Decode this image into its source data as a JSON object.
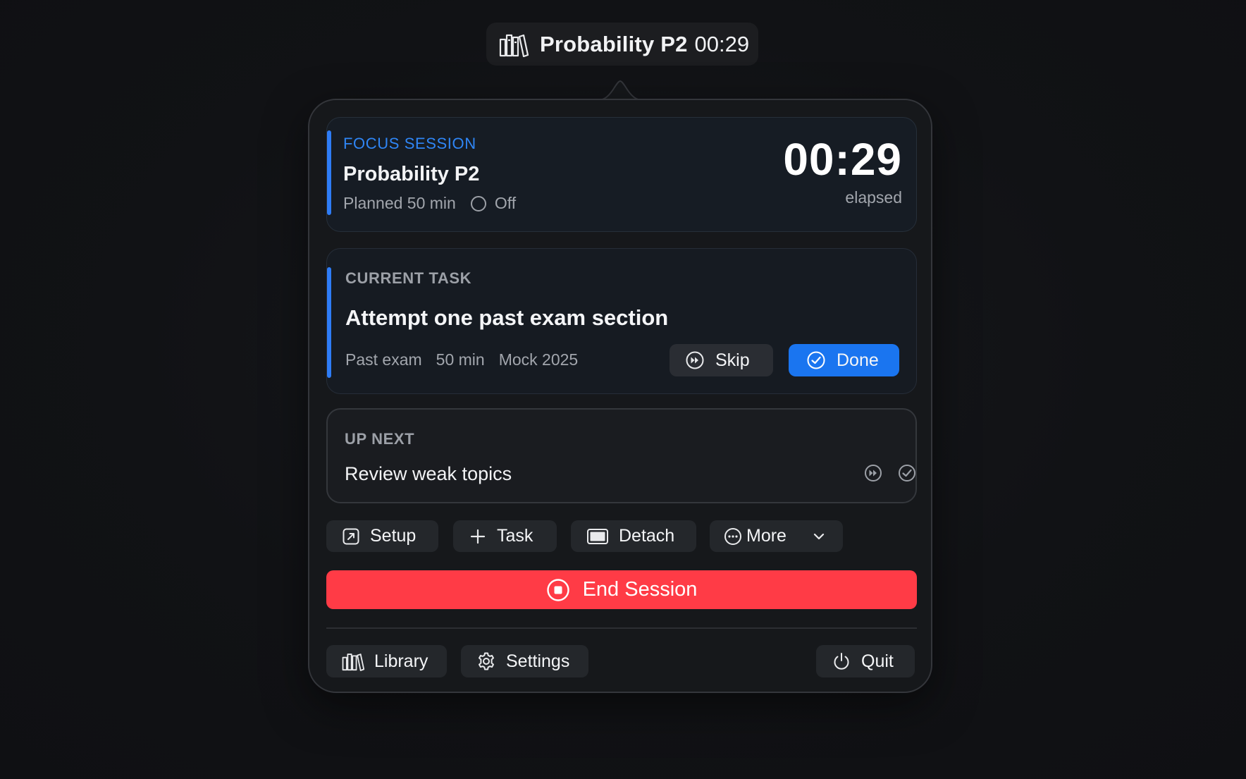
{
  "menubar": {
    "title": "Probability P2",
    "time": "00:29",
    "icon": "books-icon"
  },
  "focus": {
    "label": "FOCUS SESSION",
    "title": "Probability P2",
    "planned": "Planned 50 min",
    "toggle_state": "Off",
    "timer": "00:29",
    "timer_label": "elapsed",
    "accent_color": "#2e7cf6"
  },
  "current_task": {
    "label": "CURRENT TASK",
    "title": "Attempt one past exam section",
    "tags": [
      "Past exam",
      "50 min",
      "Mock 2025"
    ],
    "skip_label": "Skip",
    "done_label": "Done"
  },
  "up_next": {
    "label": "UP NEXT",
    "title": "Review weak topics"
  },
  "actions": {
    "setup": "Setup",
    "task": "Task",
    "detach": "Detach",
    "more": "More"
  },
  "end_session": {
    "label": "End Session",
    "color": "#ff3b46"
  },
  "footer": {
    "library": "Library",
    "settings": "Settings",
    "quit": "Quit"
  }
}
